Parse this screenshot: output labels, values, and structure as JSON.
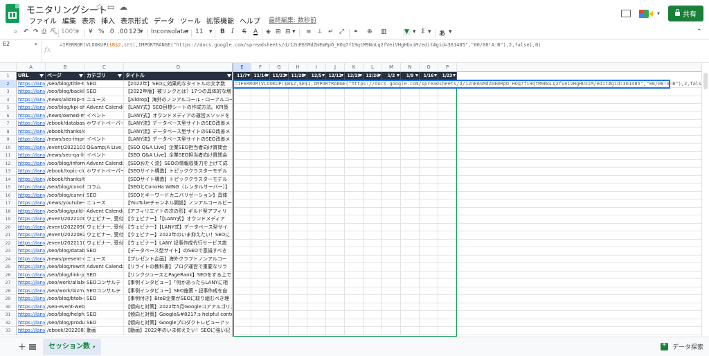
{
  "title_bar": {
    "doc_title": "モニタリングシート",
    "menu": [
      "ファイル",
      "編集",
      "表示",
      "挿入",
      "表示形式",
      "データ",
      "ツール",
      "拡張機能",
      "ヘルプ"
    ],
    "last_edit": "最終編集: 数秒前",
    "share_label": "共有"
  },
  "toolbar": {
    "zoom": "100%",
    "currency": "¥",
    "percent": "%",
    "dec_less": ".0",
    "dec_more": ".00",
    "format_num": "123",
    "font": "Inconsolata",
    "font_size": "11",
    "bold": "B",
    "italic": "I",
    "strike": "S",
    "text_color": "A",
    "sigma": "Σ",
    "input_tools": "あ"
  },
  "formula_bar": {
    "name_box": "E2",
    "fx": "fx",
    "f_prefix": "=IFERROR(VLOOKUP(",
    "f_ref1": "$B$2",
    "f_comma": ",",
    "f_ref2": "$E$1",
    "f_suffix": ",IMPORTRANGE(\"https://docs.google.com/spreadsheets/d/12nE6SMdZmEmRpO_HOq7f19qtM9NoLq2fVeiVHgHUxiM/edit#gid=361485\",\"00/00!A:B\"),2,false),0)"
  },
  "columns": {
    "letters": [
      "A",
      "B",
      "C",
      "D",
      "E",
      "F",
      "G",
      "H",
      "I",
      "J",
      "K",
      "L",
      "M",
      "N",
      "O",
      "P"
    ]
  },
  "header_row": {
    "url": "URL",
    "page": "ページ",
    "category": "カテゴリ",
    "title": "タイトル",
    "dates": [
      "11/7",
      "11/14",
      "11/21",
      "11/28",
      "12/5",
      "12/12",
      "12/19",
      "12/26",
      "1/2",
      "1/9",
      "1/16",
      "1/23"
    ]
  },
  "active_cell_text": "=IFERROR(VLOOKUP($B$2,$E$1,IMPORTRANGE(\"https://docs.google.com/spreadsheets/d/12nE6SMdZmEmRpO_HOq7f19qtM9NoLq2fVeiVHgHUxiM/edit#gid=361485\",\"00/00!A:B\"),2,false),0)",
  "rows": [
    {
      "n": "1"
    },
    {
      "n": "2",
      "a": "https://lany.c",
      "b": "/seo/blog/title-tag",
      "c": "SEO",
      "d": "【2022年】SEOに効果的なタイトルの文字数"
    },
    {
      "n": "3",
      "a": "https://lany.c",
      "b": "/seo/blog/backlink",
      "c": "SEO",
      "d": "【2022年版】被リンクとは？17つの具体的な増"
    },
    {
      "n": "4",
      "a": "https://lany.c",
      "b": "/news/alldrop-no",
      "c": "ニュース",
      "d": "【Alldrop】海外のノンアルコール・ローアルコー"
    },
    {
      "n": "5",
      "a": "https://lany.c",
      "b": "/seo/blog/kpi-she",
      "c": "Advent Calendar",
      "d": "【LANY式】SEO目標シートの作成方法。KPI策"
    },
    {
      "n": "6",
      "a": "https://lany.c",
      "b": "/news/owned-me",
      "c": "イベント",
      "d": "【LANY式】オウンドメディアの運営メソッドを"
    },
    {
      "n": "7",
      "a": "https://lany.c",
      "b": "/ebook/database",
      "c": "ホワイトペーパー",
      "d": "【LANY流】データベース型サイトのSEO改善メ"
    },
    {
      "n": "8",
      "a": "https://lany.c",
      "b": "/ebook/thanks/d",
      "c": "",
      "d": "【LANY流】データベース型サイトのSEO改善メ"
    },
    {
      "n": "9",
      "a": "https://lany.c",
      "b": "/news/seo-impro",
      "c": "イベント",
      "d": "【LANY流】データベース型サイトのSEO改善メ"
    },
    {
      "n": "10",
      "a": "https://lany.c",
      "b": "/event/2022101",
      "c": "Q&amp;A Live_",
      "d": "【SEO Q&A Live】企業SEO担当者向け質問会"
    },
    {
      "n": "11",
      "a": "https://lany.c",
      "b": "/news/seo-qa-liv",
      "c": "イベント",
      "d": "【SEO Q&A Live】企業SEO担当者向け質問会"
    },
    {
      "n": "12",
      "a": "https://lany.c",
      "b": "/seo/blog/inform",
      "c": "Advent Calendar",
      "d": "【SEOおたく流】SEOの情報収集力を上げて成"
    },
    {
      "n": "13",
      "a": "https://lany.c",
      "b": "/ebook/topic-clu",
      "c": "ホワイトペーパー",
      "d": "【SEOサイト構造】トピッククラスターモデル"
    },
    {
      "n": "14",
      "a": "https://lany.c",
      "b": "/ebook/thanks/to",
      "c": "",
      "d": "【SEOサイト構造】トピッククラスターモデル"
    },
    {
      "n": "15",
      "a": "https://lany.c",
      "b": "/seo/blog/conoh",
      "c": "コラム",
      "d": "【SEOとConoHa WING（レンタルサーバー）】"
    },
    {
      "n": "16",
      "a": "https://lany.c",
      "b": "/seo/blog/cannib",
      "c": "SEO",
      "d": "【SEOとキーワードカニバリゼーション】具体"
    },
    {
      "n": "17",
      "a": "https://lany.c",
      "b": "/news/youtube-c",
      "c": "ニュース",
      "d": "【YouTubeチャンネル開設】ノンアルコールビー"
    },
    {
      "n": "18",
      "a": "https://lany.c",
      "b": "/seo/blog/guild-a",
      "c": "Advent Calendar",
      "d": "【アフィリエイトの次の形】ギルド型アフィリ"
    },
    {
      "n": "19",
      "a": "https://lany.c",
      "b": "/event/2022100",
      "c": "ウェビナー, 受付",
      "d": "【ウェビナー】「【LANY式】オウンドメディア"
    },
    {
      "n": "20",
      "a": "https://lany.c",
      "b": "/event/2022090",
      "c": "ウェビナー, 受付",
      "d": "【ウェビナー】【LANY式】データベース型サイ"
    },
    {
      "n": "21",
      "a": "https://lany.c",
      "b": "/event/2022082",
      "c": "ウェビナー, 受付",
      "d": "【ウェビナー】2022年のいま抑えたい！SEOに"
    },
    {
      "n": "22",
      "a": "https://lany.c",
      "b": "/event/2022110",
      "c": "ウェビナー, 受付",
      "d": "【ウェビナー】LANY 記事作成代行サービス説"
    },
    {
      "n": "23",
      "a": "https://lany.c",
      "b": "/seo/blog/databa",
      "c": "SEO",
      "d": "【データベース型サイト】のSEOで意識すべき"
    },
    {
      "n": "24",
      "a": "https://lany.c",
      "b": "/news/present-c",
      "c": "ニュース",
      "d": "【プレゼント企画】海外クラフトノンアルコー"
    },
    {
      "n": "25",
      "a": "https://lany.c",
      "b": "/seo/blog/rewrite",
      "c": "Advent Calendar",
      "d": "【リライトの教科書】ブログ運営で重要なリラ"
    },
    {
      "n": "26",
      "a": "https://lany.c",
      "b": "/seo/blog/link-jui",
      "c": "SEO",
      "d": "【リンクジュースとPageRank】SEOをする上で"
    },
    {
      "n": "27",
      "a": "https://lany.c",
      "b": "/seo/work/allabo",
      "c": "SEOコンサルテ",
      "d": "【事例インタビュー】「何かあったらLANYに相"
    },
    {
      "n": "28",
      "a": "https://lany.c",
      "b": "/seo/work/bizma",
      "c": "SEOコンサルテ",
      "d": "【事例インタビュー】SEO施策・記事作成を自"
    },
    {
      "n": "29",
      "a": "https://lany.c",
      "b": "/seo/blog/btob-s",
      "c": "SEO",
      "d": "【事例付き】BtoB企業がSEOに取り組むべき理"
    },
    {
      "n": "30",
      "a": "https://lany.c",
      "b": "/seo-event-webi",
      "c": "",
      "d": "【傾向と対策】2022年5月Googleコアアルゴリズ"
    },
    {
      "n": "31",
      "a": "https://lany.c",
      "b": "/seo/blog/helpful",
      "c": "SEO",
      "d": "【傾向と対策】Google&#8217;s helpful content"
    },
    {
      "n": "32",
      "a": "https://lany.c",
      "b": "/seo/blog/produc",
      "c": "SEO",
      "d": "【傾向と対策】Googleプロダクトレビューアッ"
    },
    {
      "n": "33",
      "a": "https://lany.c",
      "b": "/ebook/2022082",
      "c": "動画",
      "d": "【動画】2022年のいま抑えたい！SEOに強い記"
    }
  ],
  "sheet_tab": "セッション数",
  "explore_label": "データ探索",
  "colors": {
    "header_bg": "#263040",
    "link": "#1155cc",
    "share": "#188038",
    "selection": "#1a73e8"
  }
}
